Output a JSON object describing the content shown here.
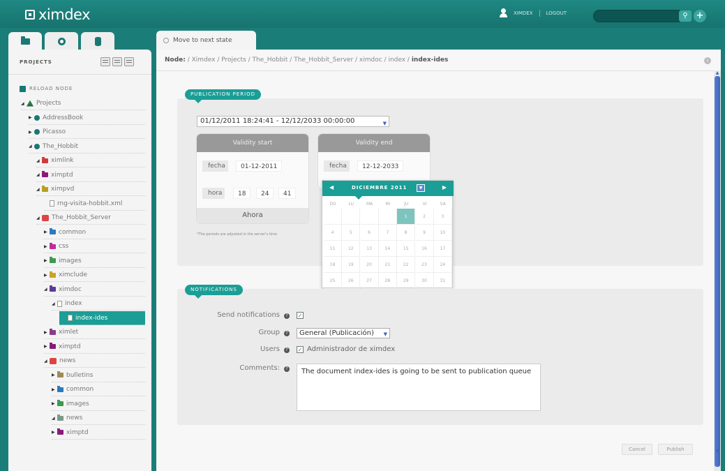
{
  "header": {
    "logo": "ximdex",
    "user": "XIMDEX",
    "logout": "LOGOUT",
    "search_value": ""
  },
  "left": {
    "tabs": [
      "projects-folder-icon",
      "gear-icon",
      "database-icon"
    ],
    "title": "PROJECTS",
    "reload": "RELOAD NODE",
    "tree": [
      {
        "label": "Projects",
        "depth": 0,
        "icon": "project",
        "color": "#3a8a4e",
        "expanded": true
      },
      {
        "label": "AddressBook",
        "depth": 1,
        "icon": "globe",
        "color": "#1a7873",
        "expanded": false
      },
      {
        "label": "Picasso",
        "depth": 1,
        "icon": "globe",
        "color": "#1a7873",
        "expanded": false
      },
      {
        "label": "The_Hobbit",
        "depth": 1,
        "icon": "globe",
        "color": "#1a7873",
        "expanded": true
      },
      {
        "label": "ximlink",
        "depth": 2,
        "icon": "folder",
        "color": "#d23a3a",
        "expanded": true
      },
      {
        "label": "ximptd",
        "depth": 2,
        "icon": "folder",
        "color": "#8a1a7a",
        "expanded": true
      },
      {
        "label": "ximpvd",
        "depth": 2,
        "icon": "folder",
        "color": "#b8a020",
        "expanded": true
      },
      {
        "label": "rng-visita-hobbit.xml",
        "depth": 3,
        "icon": "file",
        "color": "#999",
        "expanded": null
      },
      {
        "label": "The_Hobbit_Server",
        "depth": 2,
        "icon": "server",
        "color": "#d44",
        "expanded": true
      },
      {
        "label": "common",
        "depth": 3,
        "icon": "folder",
        "color": "#2a7ac0",
        "expanded": false
      },
      {
        "label": "css",
        "depth": 3,
        "icon": "folder",
        "color": "#c02a9a",
        "expanded": false
      },
      {
        "label": "images",
        "depth": 3,
        "icon": "folder",
        "color": "#3a9a4e",
        "expanded": false
      },
      {
        "label": "ximclude",
        "depth": 3,
        "icon": "folder",
        "color": "#d0a020",
        "expanded": false
      },
      {
        "label": "ximdoc",
        "depth": 3,
        "icon": "folder",
        "color": "#5a3a9a",
        "expanded": true
      },
      {
        "label": "index",
        "depth": 4,
        "icon": "file",
        "color": "#999",
        "expanded": true
      },
      {
        "label": "index-ides",
        "depth": 5,
        "icon": "file",
        "color": "#fff",
        "expanded": null,
        "selected": true
      },
      {
        "label": "ximlet",
        "depth": 3,
        "icon": "folder",
        "color": "#8a3a8a",
        "expanded": false
      },
      {
        "label": "ximptd",
        "depth": 3,
        "icon": "folder",
        "color": "#8a1a7a",
        "expanded": false
      },
      {
        "label": "news",
        "depth": 3,
        "icon": "server",
        "color": "#d44",
        "expanded": true
      },
      {
        "label": "bulletins",
        "depth": 4,
        "icon": "folder",
        "color": "#a08a5a",
        "expanded": false
      },
      {
        "label": "common",
        "depth": 4,
        "icon": "folder",
        "color": "#2a7ac0",
        "expanded": false
      },
      {
        "label": "images",
        "depth": 4,
        "icon": "folder",
        "color": "#3a9a4e",
        "expanded": false
      },
      {
        "label": "news",
        "depth": 4,
        "icon": "folder",
        "color": "#7a9a8a",
        "expanded": true
      },
      {
        "label": "ximptd",
        "depth": 4,
        "icon": "folder",
        "color": "#8a1a7a",
        "expanded": false
      }
    ]
  },
  "main": {
    "tab_label": "Move to next state",
    "breadcrumb_prefix": "Node:",
    "breadcrumb_path": " / Ximdex / Projects / The_Hobbit / The_Hobbit_Server / ximdoc / index / ",
    "breadcrumb_current": "index-ides",
    "publication": {
      "label": "PUBLICATION PERIOD",
      "period_value": "01/12/2011 18:24:41 - 12/12/2033 00:00:00",
      "start": {
        "title": "Validity start",
        "fecha_label": "fecha",
        "fecha": "01-12-2011",
        "hora_label": "hora",
        "h": "18",
        "m": "24",
        "s": "41",
        "now": "Ahora"
      },
      "end": {
        "title": "Validity end",
        "fecha_label": "fecha",
        "fecha": "12-12-2033"
      },
      "note": "*The periods are adjusted in the server's time"
    },
    "calendar": {
      "title": "DICIEMBRE 2011",
      "dow": [
        "DO",
        "LU",
        "MA",
        "MI",
        "JU",
        "VI",
        "SA"
      ],
      "weeks": [
        [
          "",
          "",
          "",
          "",
          "1",
          "2",
          "3"
        ],
        [
          "4",
          "5",
          "6",
          "7",
          "8",
          "9",
          "10"
        ],
        [
          "11",
          "12",
          "13",
          "14",
          "15",
          "16",
          "17"
        ],
        [
          "18",
          "19",
          "20",
          "21",
          "22",
          "23",
          "24"
        ],
        [
          "25",
          "26",
          "27",
          "28",
          "29",
          "30",
          "31"
        ]
      ],
      "selected": "1"
    },
    "notifications": {
      "label": "NOTIFICATIONS",
      "send_label": "Send notifications",
      "group_label": "Group",
      "group_value": "General (Publicación)",
      "users_label": "Users",
      "user_value": "Administrador de ximdex",
      "comments_label": "Comments:",
      "comments_value": "The document index-ides is going to be sent to publication queue"
    },
    "buttons": {
      "cancel": "Cancel",
      "publish": "Publish"
    }
  }
}
